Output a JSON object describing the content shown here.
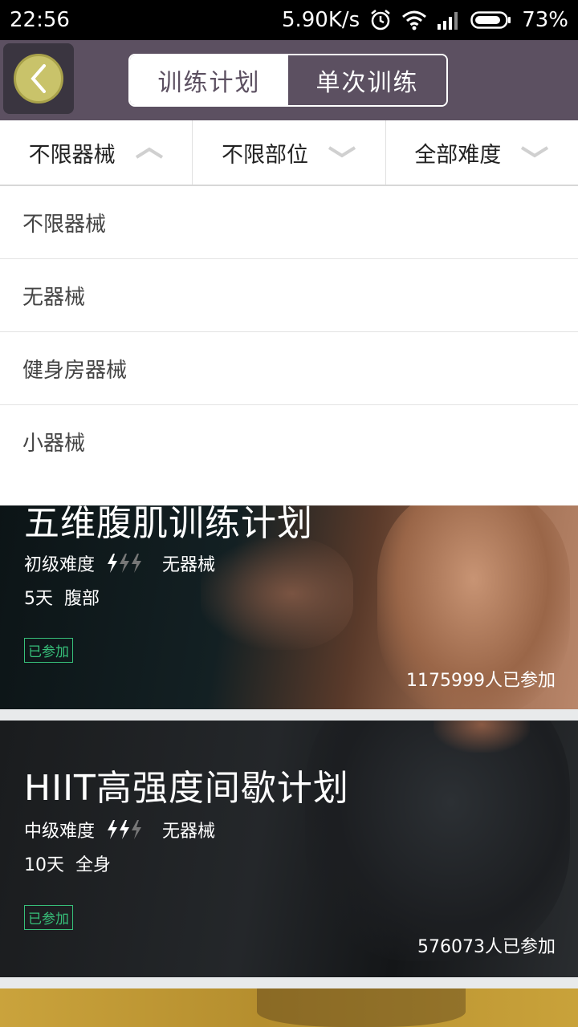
{
  "status_bar": {
    "time": "22:56",
    "net_speed": "5.90K/s",
    "battery": "73%"
  },
  "nav": {
    "tabs": [
      {
        "label": "训练计划",
        "active": true
      },
      {
        "label": "单次训练",
        "active": false
      }
    ]
  },
  "filters": [
    {
      "label": "不限器械",
      "expanded": true
    },
    {
      "label": "不限部位",
      "expanded": false
    },
    {
      "label": "全部难度",
      "expanded": false
    }
  ],
  "dropdown": {
    "options": [
      "不限器械",
      "无器械",
      "健身房器械",
      "小器械"
    ]
  },
  "cards": [
    {
      "title": "五维腹肌训练计划",
      "difficulty": "初级难度",
      "level": 1,
      "equipment": "无器械",
      "days": "5天",
      "body_part": "腹部",
      "badge": "已参加",
      "participants": "1175999人已参加"
    },
    {
      "title": "HIIT高强度间歇计划",
      "difficulty": "中级难度",
      "level": 2,
      "equipment": "无器械",
      "days": "10天",
      "body_part": "全身",
      "badge": "已参加",
      "participants": "576073人已参加"
    }
  ],
  "colors": {
    "nav_bg": "#5c5061",
    "back_button": "#c9c36a",
    "badge": "#37c07a"
  }
}
